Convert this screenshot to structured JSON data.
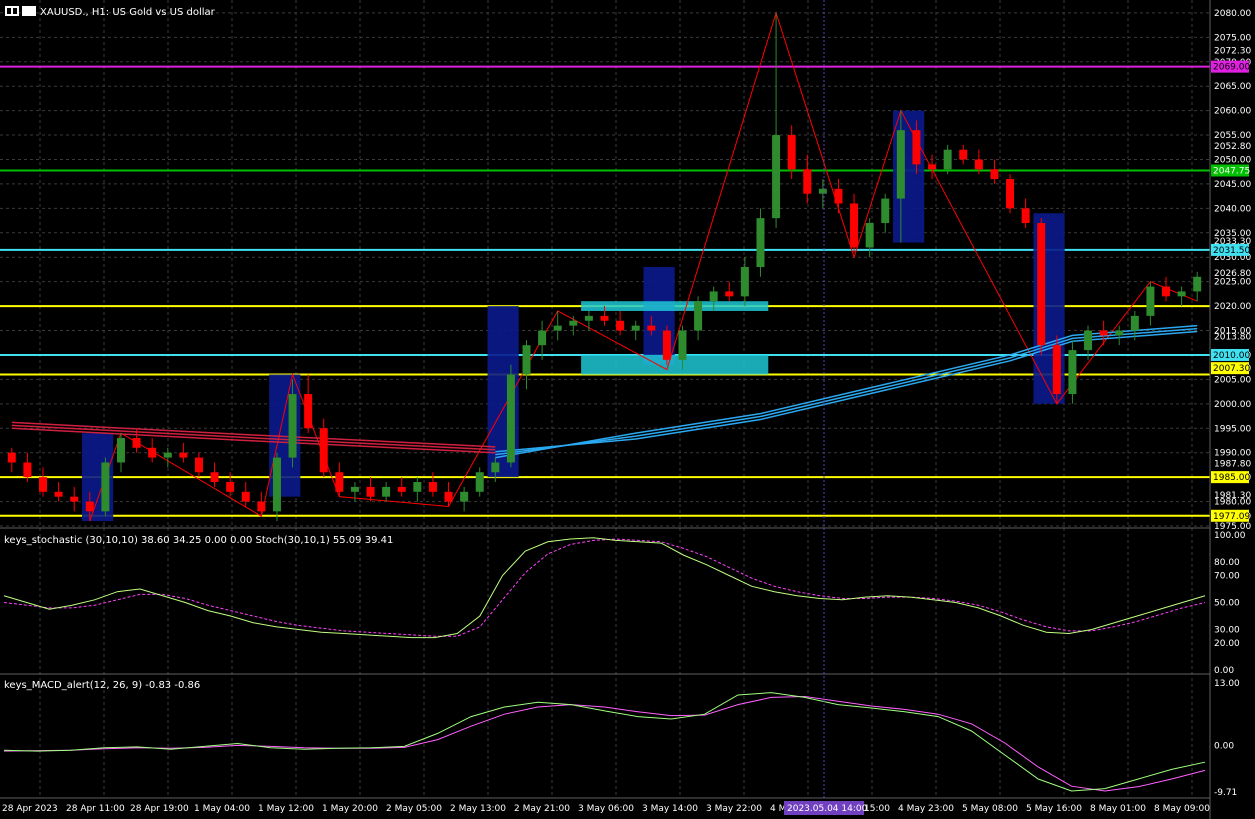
{
  "header": {
    "symbol_title": "XAUUSD., H1: US Gold vs US dollar",
    "stoch_title": "keys_stochastic (30,10,10) 38.60 34.25 0.00 0.00 Stoch(30,10,1) 55.09 39.41",
    "macd_title": "keys_MACD_alert(12, 26, 9) -0.83 -0.86"
  },
  "colors": {
    "background": "#000000",
    "bull": "#2e8b2e",
    "bear": "#ff0000",
    "zone_blue": "#0a1a8c",
    "zone_cyan": "#1ec8d6",
    "line_magenta": "#e020e0",
    "line_green": "#00c000",
    "line_cyan": "#40e0f0",
    "line_yellow": "#ffff00",
    "ma_blue": "#2aa8f0",
    "ma_red": "#d02040",
    "stoch_main": "#c0ff80",
    "stoch_signal": "#ff40ff",
    "stoch_raw": "#a0a0c0",
    "macd_main": "#a0ff80",
    "macd_signal": "#ff60ff"
  },
  "price_axis": {
    "ticks": [
      "2080.00",
      "2075.00",
      "2072.30",
      "2070.00",
      "2065.00",
      "2060.00",
      "2055.00",
      "2052.80",
      "2050.00",
      "2045.00",
      "2040.00",
      "2035.00",
      "2033.30",
      "2030.00",
      "2026.80",
      "2025.00",
      "2020.00",
      "2015.00",
      "2013.80",
      "2010.00",
      "2007.30",
      "2005.00",
      "2000.00",
      "1995.00",
      "1990.00",
      "1987.80",
      "1985.00",
      "1981.30",
      "1980.00",
      "1977.09",
      "1975.00"
    ],
    "highlights": [
      {
        "label": "2069.00",
        "color": "#e020e0",
        "text_color": "#000"
      },
      {
        "label": "2047.75",
        "color": "#00c000",
        "text_color": "#fff"
      },
      {
        "label": "2031.50",
        "color": "#40e0f0",
        "text_color": "#000"
      },
      {
        "label": "2010.00",
        "color": "#40e0f0",
        "text_color": "#000"
      },
      {
        "label": "2007.30",
        "color": "#ffff00",
        "text_color": "#000"
      },
      {
        "label": "1985.00",
        "color": "#ffff00",
        "text_color": "#000"
      },
      {
        "label": "1977.09",
        "color": "#ffff00",
        "text_color": "#000"
      }
    ]
  },
  "stoch_axis": {
    "ticks": [
      "100.00",
      "80.00",
      "70.00",
      "50.00",
      "30.00",
      "20.00",
      "0.00"
    ]
  },
  "macd_axis": {
    "ticks": [
      "13.00",
      "0.00",
      "-9.71"
    ]
  },
  "time_axis": {
    "labels": [
      "28 Apr 2023",
      "28 Apr 11:00",
      "28 Apr 19:00",
      "1 May 04:00",
      "1 May 12:00",
      "1 May 20:00",
      "2 May 05:00",
      "2 May 13:00",
      "2 May 21:00",
      "3 May 06:00",
      "3 May 14:00",
      "3 May 22:00",
      "4 M",
      "4 May 15:00",
      "4 May 23:00",
      "5 May 08:00",
      "5 May 16:00",
      "8 May 01:00",
      "8 May 09:00"
    ],
    "crosshair_label": "2023.05.04 14:00"
  },
  "chart_data": {
    "type": "candlestick",
    "symbol": "XAUUSD.",
    "timeframe": "H1",
    "ylim": [
      1975,
      2081
    ],
    "candles": [
      [
        1990,
        1991,
        1986,
        1988
      ],
      [
        1988,
        1990,
        1984,
        1985
      ],
      [
        1985,
        1987,
        1981,
        1982
      ],
      [
        1982,
        1984,
        1980,
        1981
      ],
      [
        1981,
        1983,
        1978,
        1980
      ],
      [
        1980,
        1982,
        1976,
        1978
      ],
      [
        1978,
        1989,
        1977,
        1988
      ],
      [
        1988,
        1994,
        1986,
        1993
      ],
      [
        1993,
        1995,
        1990,
        1991
      ],
      [
        1991,
        1993,
        1988,
        1989
      ],
      [
        1989,
        1991,
        1987,
        1990
      ],
      [
        1990,
        1992,
        1988,
        1989
      ],
      [
        1989,
        1990,
        1985,
        1986
      ],
      [
        1986,
        1988,
        1983,
        1984
      ],
      [
        1984,
        1986,
        1981,
        1982
      ],
      [
        1982,
        1984,
        1979,
        1980
      ],
      [
        1980,
        1982,
        1977,
        1978
      ],
      [
        1978,
        1990,
        1976,
        1989
      ],
      [
        1989,
        2005,
        1987,
        2002
      ],
      [
        2002,
        2006,
        1994,
        1995
      ],
      [
        1995,
        1997,
        1985,
        1986
      ],
      [
        1986,
        1988,
        1981,
        1982
      ],
      [
        1982,
        1984,
        1980,
        1983
      ],
      [
        1983,
        1985,
        1980,
        1981
      ],
      [
        1981,
        1984,
        1980,
        1983
      ],
      [
        1983,
        1985,
        1981,
        1982
      ],
      [
        1982,
        1985,
        1980,
        1984
      ],
      [
        1984,
        1986,
        1981,
        1982
      ],
      [
        1982,
        1984,
        1979,
        1980
      ],
      [
        1980,
        1983,
        1978,
        1982
      ],
      [
        1982,
        1987,
        1981,
        1986
      ],
      [
        1986,
        1989,
        1984,
        1988
      ],
      [
        1988,
        2008,
        1987,
        2006
      ],
      [
        2006,
        2013,
        2003,
        2012
      ],
      [
        2012,
        2017,
        2009,
        2015
      ],
      [
        2015,
        2019,
        2013,
        2016
      ],
      [
        2016,
        2018,
        2014,
        2017
      ],
      [
        2017,
        2019,
        2015,
        2018
      ],
      [
        2018,
        2020,
        2016,
        2017
      ],
      [
        2017,
        2019,
        2014,
        2015
      ],
      [
        2015,
        2017,
        2013,
        2016
      ],
      [
        2016,
        2018,
        2014,
        2015
      ],
      [
        2015,
        2016,
        2008,
        2009
      ],
      [
        2009,
        2016,
        2007,
        2015
      ],
      [
        2015,
        2022,
        2013,
        2021
      ],
      [
        2021,
        2024,
        2019,
        2023
      ],
      [
        2023,
        2025,
        2021,
        2022
      ],
      [
        2022,
        2030,
        2020,
        2028
      ],
      [
        2028,
        2040,
        2026,
        2038
      ],
      [
        2038,
        2080,
        2036,
        2055
      ],
      [
        2055,
        2057,
        2046,
        2048
      ],
      [
        2048,
        2051,
        2041,
        2043
      ],
      [
        2043,
        2046,
        2040,
        2044
      ],
      [
        2044,
        2046,
        2039,
        2041
      ],
      [
        2041,
        2043,
        2031,
        2032
      ],
      [
        2032,
        2038,
        2030,
        2037
      ],
      [
        2037,
        2043,
        2035,
        2042
      ],
      [
        2042,
        2060,
        2033,
        2056
      ],
      [
        2056,
        2058,
        2047,
        2049
      ],
      [
        2049,
        2051,
        2046,
        2048
      ],
      [
        2048,
        2053,
        2047,
        2052
      ],
      [
        2052,
        2053,
        2049,
        2050
      ],
      [
        2050,
        2052,
        2047,
        2048
      ],
      [
        2048,
        2050,
        2045,
        2046
      ],
      [
        2046,
        2047,
        2039,
        2040
      ],
      [
        2040,
        2042,
        2036,
        2037
      ],
      [
        2037,
        2038,
        2010,
        2012
      ],
      [
        2012,
        2014,
        2000,
        2002
      ],
      [
        2002,
        2013,
        2000,
        2011
      ],
      [
        2011,
        2016,
        2009,
        2015
      ],
      [
        2015,
        2017,
        2012,
        2014
      ],
      [
        2014,
        2016,
        2012,
        2015
      ],
      [
        2015,
        2019,
        2013,
        2018
      ],
      [
        2018,
        2025,
        2016,
        2024
      ],
      [
        2024,
        2026,
        2021,
        2022
      ],
      [
        2022,
        2024,
        2020,
        2023
      ],
      [
        2023,
        2027,
        2021,
        2026
      ]
    ],
    "horizontal_levels": [
      {
        "price": 2069.0,
        "color": "#e020e0"
      },
      {
        "price": 2047.75,
        "color": "#00c000"
      },
      {
        "price": 2031.5,
        "color": "#40e0f0"
      },
      {
        "price": 2020.0,
        "color": "#ffff00"
      },
      {
        "price": 2010.0,
        "color": "#40e0f0"
      },
      {
        "price": 2006.0,
        "color": "#ffff00"
      },
      {
        "price": 1985.0,
        "color": "#ffff00"
      },
      {
        "price": 1977.09,
        "color": "#ffff00"
      }
    ],
    "stochastic": {
      "main": [
        55,
        50,
        45,
        48,
        52,
        58,
        60,
        55,
        50,
        44,
        40,
        35,
        32,
        30,
        28,
        27,
        26,
        25,
        24,
        24,
        27,
        40,
        70,
        88,
        95,
        97,
        98,
        96,
        95,
        94,
        85,
        78,
        70,
        62,
        58,
        55,
        53,
        52,
        54,
        55,
        54,
        52,
        50,
        46,
        40,
        33,
        28,
        27,
        30,
        35,
        40,
        45,
        50,
        55
      ],
      "signal": [
        50,
        48,
        46,
        46,
        48,
        52,
        56,
        56,
        53,
        48,
        44,
        40,
        36,
        33,
        31,
        29,
        28,
        27,
        26,
        25,
        25,
        32,
        52,
        72,
        86,
        93,
        96,
        97,
        96,
        95,
        90,
        84,
        76,
        68,
        62,
        58,
        55,
        53,
        53,
        54,
        54,
        53,
        51,
        48,
        43,
        37,
        32,
        29,
        29,
        32,
        36,
        41,
        46,
        50
      ]
    },
    "macd": {
      "main": [
        -1,
        -1.2,
        -1.0,
        -0.5,
        -0.3,
        -0.8,
        -0.2,
        0.4,
        -0.5,
        -0.8,
        -0.6,
        -0.5,
        -0.2,
        2.5,
        6.0,
        8.0,
        9.0,
        8.5,
        7.2,
        6.0,
        5.5,
        6.5,
        10.5,
        11.0,
        10.0,
        8.5,
        7.8,
        7.0,
        6.0,
        3.0,
        -2.0,
        -7.0,
        -9.5,
        -9.0,
        -7.0,
        -5.0,
        -3.5
      ],
      "signal": [
        -1.2,
        -1.1,
        -1.0,
        -0.7,
        -0.5,
        -0.6,
        -0.4,
        0.0,
        -0.2,
        -0.5,
        -0.6,
        -0.6,
        -0.4,
        1.2,
        4.0,
        6.5,
        8.0,
        8.5,
        8.0,
        7.0,
        6.2,
        6.3,
        8.5,
        10.0,
        10.2,
        9.2,
        8.2,
        7.5,
        6.5,
        4.5,
        0.5,
        -4.5,
        -8.5,
        -9.5,
        -8.6,
        -7.0,
        -5.2
      ]
    }
  }
}
